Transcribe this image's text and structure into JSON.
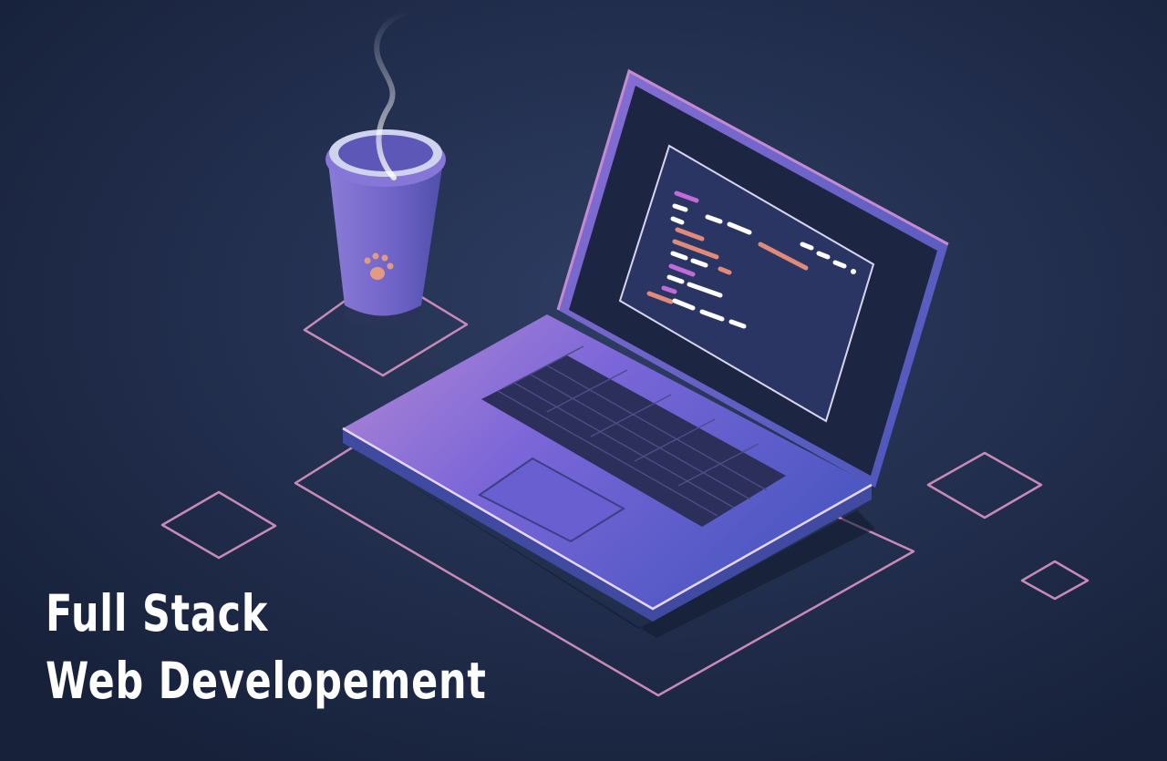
{
  "headline": {
    "line1": "Full Stack",
    "line2": "Web Developement"
  },
  "colors": {
    "background": "#1e2a47",
    "outline_pink": "#c98ab8",
    "laptop_purple": "#6f5fd0",
    "text": "#ffffff"
  },
  "icons": [
    "coffee-cup-icon",
    "paw-print-icon",
    "laptop-icon",
    "steam-icon"
  ]
}
